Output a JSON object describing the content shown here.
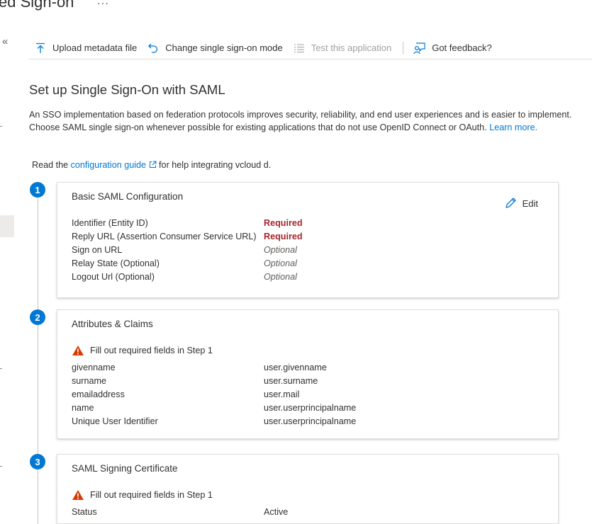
{
  "header": {
    "title": "ed Sign-on",
    "more_glyph": "···"
  },
  "nav": {
    "collapse_glyph": "«"
  },
  "toolbar": {
    "upload": {
      "label": "Upload metadata file",
      "icon": "upload-icon"
    },
    "change_mode": {
      "label": "Change single sign-on mode",
      "icon": "undo-icon"
    },
    "test": {
      "label": "Test this application",
      "icon": "list-icon"
    },
    "feedback": {
      "label": "Got feedback?",
      "icon": "feedback-person-icon"
    }
  },
  "main": {
    "title": "Set up Single Sign-On with SAML",
    "description": "An SSO implementation based on federation protocols improves security, reliability, and end user experiences and is easier to implement. Choose SAML single sign-on whenever possible for existing applications that do not use OpenID Connect or OAuth. ",
    "learn_more": "Learn more.",
    "read_prefix": "Read the ",
    "guide_link": "configuration guide",
    "read_suffix": " for help integrating vcloud d."
  },
  "steps": [
    {
      "number": "1",
      "title": "Basic SAML Configuration",
      "edit_label": "Edit",
      "rows": [
        {
          "key": "Identifier (Entity ID)",
          "value": "Required"
        },
        {
          "key": "Reply URL (Assertion Consumer Service URL)",
          "value": "Required"
        },
        {
          "key": "Sign on URL",
          "value": "Optional"
        },
        {
          "key": "Relay State (Optional)",
          "value": "Optional"
        },
        {
          "key": "Logout Url (Optional)",
          "value": "Optional"
        }
      ]
    },
    {
      "number": "2",
      "title": "Attributes & Claims",
      "warning": "Fill out required fields in Step 1",
      "rows": [
        {
          "key": "givenname",
          "value": "user.givenname"
        },
        {
          "key": "surname",
          "value": "user.surname"
        },
        {
          "key": "emailaddress",
          "value": "user.mail"
        },
        {
          "key": "name",
          "value": "user.userprincipalname"
        },
        {
          "key": "Unique User Identifier",
          "value": "user.userprincipalname"
        }
      ]
    },
    {
      "number": "3",
      "title": "SAML Signing Certificate",
      "warning": "Fill out required fields in Step 1",
      "rows": [
        {
          "key": "Status",
          "value": "Active"
        }
      ]
    }
  ],
  "colors": {
    "accent": "#0078d4",
    "required": "#a4262c",
    "warning": "#d83b01"
  }
}
